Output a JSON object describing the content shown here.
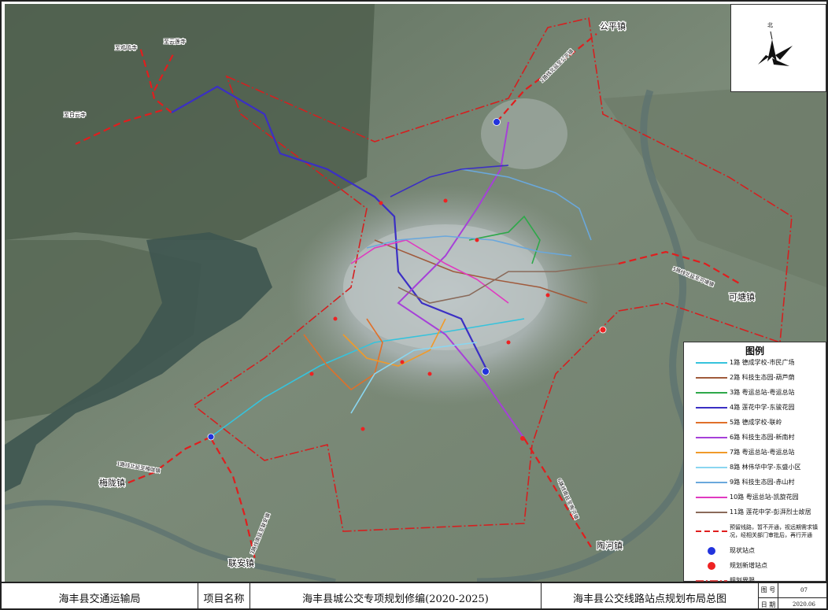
{
  "towns": {
    "gongping": "公平镇",
    "ketang": "可塘镇",
    "meilong": "梅陇镇",
    "lianan": "联安镇",
    "taohe": "陶河镇"
  },
  "destinations": {
    "jiming": "至鸡鸣寺",
    "yunlian": "至云莲寺",
    "baiyun": "至白云寺"
  },
  "extensions": {
    "gongping": "2路线北延至公平镇",
    "ketang": "5路线北延至可塘镇",
    "meilong": "1路线北延至梅陇镇",
    "lianan": "3路线南延至联安镇",
    "taohe": "6路线南延至陶河镇"
  },
  "compass": {
    "north": "北"
  },
  "legend": {
    "title": "图例",
    "routes": [
      {
        "label": "1路  德成学校-市民广场",
        "color": "#36c3dc"
      },
      {
        "label": "2路  科技生态园-葫芦荫",
        "color": "#a05a3c"
      },
      {
        "label": "3路  粤运总站-粤运总站",
        "color": "#2ea84a"
      },
      {
        "label": "4路  莲花中学-东骏花园",
        "color": "#3b2fc4"
      },
      {
        "label": "5路  德成学校-联岭",
        "color": "#e0702a"
      },
      {
        "label": "6路  科技生态园-新南村",
        "color": "#a640d8"
      },
      {
        "label": "7路  粤运总站-粤运总站",
        "color": "#f09a2a"
      },
      {
        "label": "8路  林伟华中学-东盛小区",
        "color": "#8ad6f0"
      },
      {
        "label": "9路  科技生态园-赤山村",
        "color": "#6aa8dc"
      },
      {
        "label": "10路  粤运总站-凯旋花园",
        "color": "#e03ac0"
      },
      {
        "label": "11路  莲花中学-彭湃烈士故居",
        "color": "#8a6a5a"
      }
    ],
    "planned_extension": "预留线路，暂不开通，视远期需求镇况，经相关部门审批后，再行开通",
    "current_station": "现状站点",
    "new_station": "规划新增站点",
    "boundary": "规划界限",
    "colors": {
      "extension": "#e01e1e",
      "current_station": "#2233dd",
      "new_station": "#ee2222",
      "boundary": "#d42020"
    }
  },
  "titlebar": {
    "org": "海丰县交通运输局",
    "project_label": "项目名称",
    "project_name": "海丰县城公交专项规划修编(2020-2025)",
    "drawing_title": "海丰县公交线路站点规划布局总图",
    "fig_label": "图 号",
    "fig_no": "07",
    "date_label": "日 期",
    "date": "2020.06"
  }
}
